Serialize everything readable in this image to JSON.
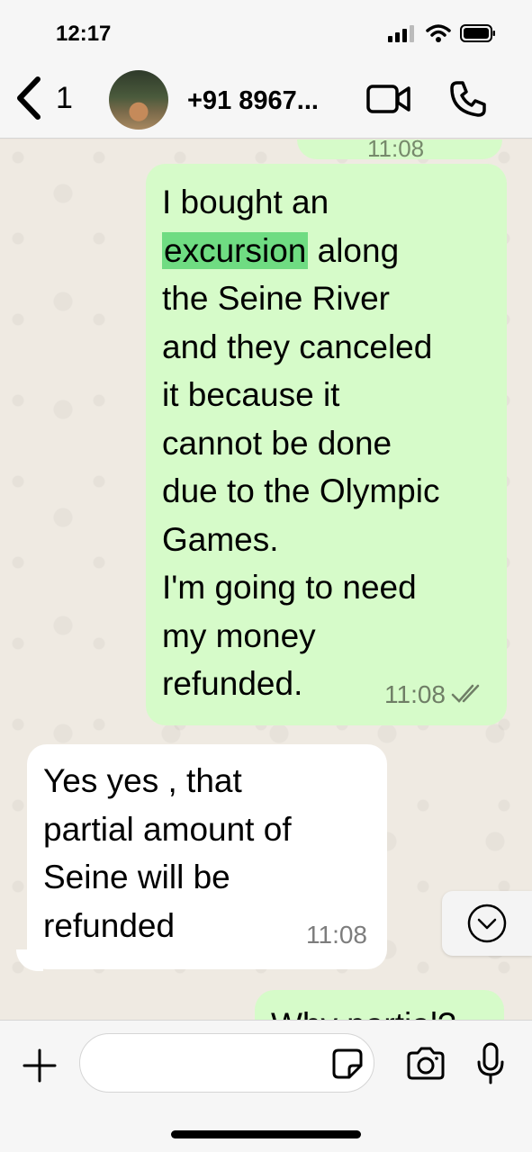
{
  "status_bar": {
    "time": "12:17"
  },
  "header": {
    "back_count": "1",
    "contact": "+91 8967..."
  },
  "messages": {
    "prev": {
      "time": "11:08"
    },
    "m1": {
      "pre": "I bought an\n",
      "highlight": "excursion",
      "post": " along\nthe Seine River\nand they canceled\nit because it\ncannot be done\ndue to the Olympic\nGames.\nI'm going to need\nmy money\nrefunded.",
      "time": "11:08"
    },
    "m2": {
      "text": "Yes yes , that\npartial amount of\nSeine will be\nrefunded",
      "time": "11:08"
    },
    "m3": {
      "text": "Why partial?"
    }
  },
  "composer": {
    "value": ""
  },
  "colors": {
    "outgoing": "#d6fbc9",
    "incoming": "#ffffff",
    "highlight": "#6fdc82"
  }
}
